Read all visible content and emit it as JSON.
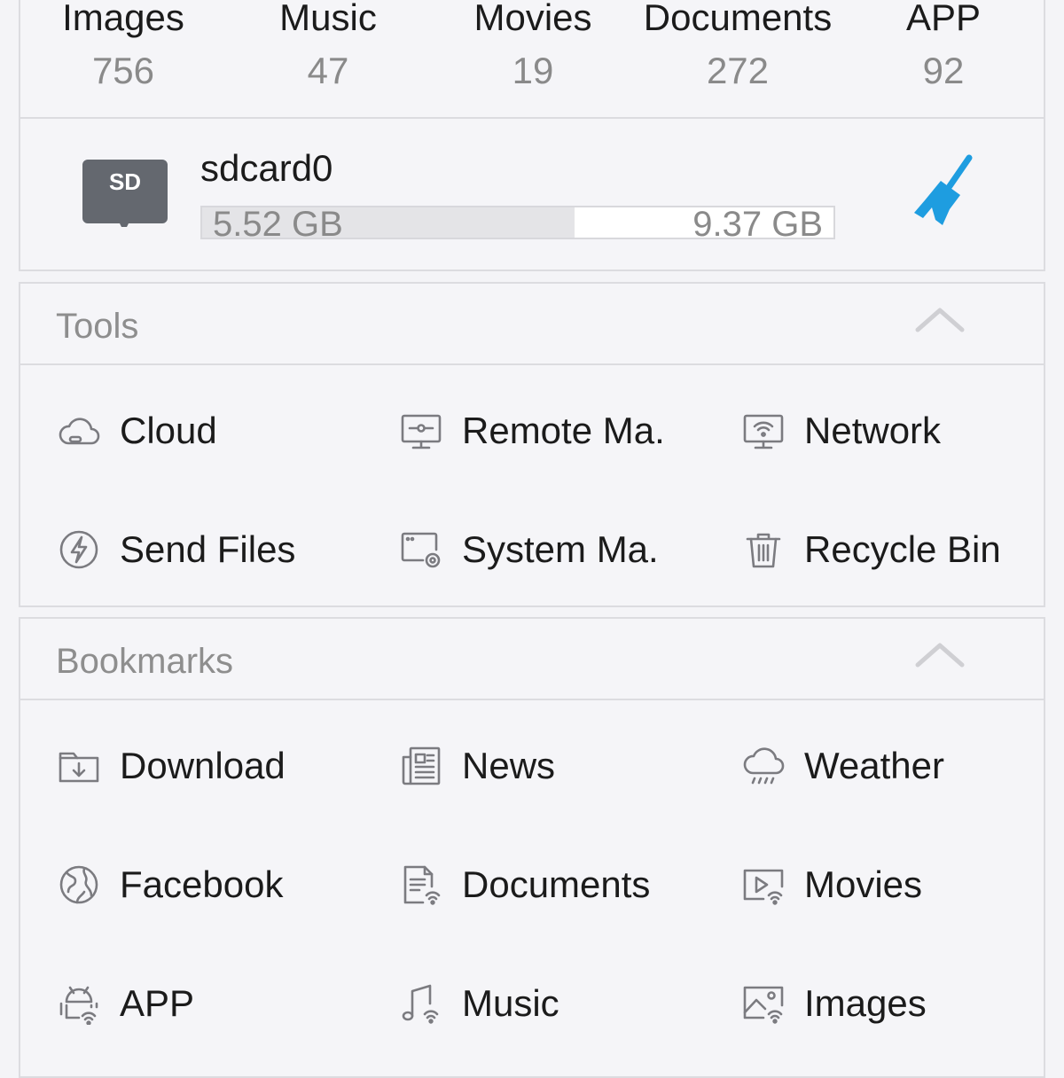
{
  "categories": [
    {
      "label": "Images",
      "count": "756"
    },
    {
      "label": "Music",
      "count": "47"
    },
    {
      "label": "Movies",
      "count": "19"
    },
    {
      "label": "Documents",
      "count": "272"
    },
    {
      "label": "APP",
      "count": "92"
    }
  ],
  "storage": {
    "name": "sdcard0",
    "sd_label": "SD",
    "used": "5.52 GB",
    "total": "9.37 GB",
    "used_fraction": 0.59,
    "clean_icon": "broom-icon",
    "accent": "#1e9de0"
  },
  "tools": {
    "title": "Tools",
    "items": [
      {
        "label": "Cloud",
        "icon": "cloud-icon"
      },
      {
        "label": "Remote Ma.",
        "icon": "monitor-icon"
      },
      {
        "label": "Network",
        "icon": "wifi-monitor-icon"
      },
      {
        "label": "Send Files",
        "icon": "lightning-icon"
      },
      {
        "label": "System Ma.",
        "icon": "window-gear-icon"
      },
      {
        "label": "Recycle Bin",
        "icon": "trash-icon"
      }
    ]
  },
  "bookmarks": {
    "title": "Bookmarks",
    "items": [
      {
        "label": "Download",
        "icon": "download-folder-icon"
      },
      {
        "label": "News",
        "icon": "newspaper-icon"
      },
      {
        "label": "Weather",
        "icon": "rain-cloud-icon"
      },
      {
        "label": "Facebook",
        "icon": "globe-icon"
      },
      {
        "label": "Documents",
        "icon": "document-wifi-icon"
      },
      {
        "label": "Movies",
        "icon": "movie-wifi-icon"
      },
      {
        "label": "APP",
        "icon": "android-wifi-icon"
      },
      {
        "label": "Music",
        "icon": "music-wifi-icon"
      },
      {
        "label": "Images",
        "icon": "image-wifi-icon"
      }
    ]
  }
}
